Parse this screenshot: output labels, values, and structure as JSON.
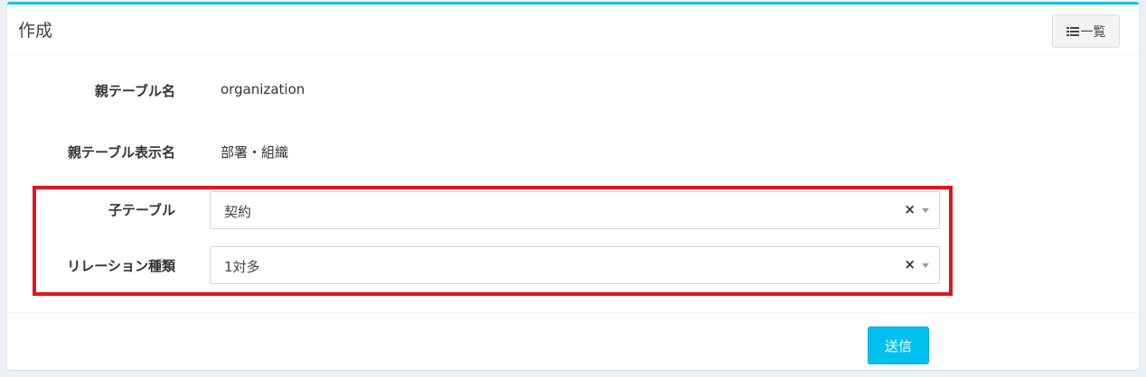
{
  "header": {
    "title": "作成",
    "list_button_label": "一覧",
    "list_button_icon": "list-icon"
  },
  "form": {
    "parent_table_name": {
      "label": "親テーブル名",
      "value": "organization"
    },
    "parent_table_display_name": {
      "label": "親テーブル表示名",
      "value": "部署・組織"
    },
    "child_table": {
      "label": "子テーブル",
      "selected": "契約",
      "clear": "×"
    },
    "relation_type": {
      "label": "リレーション種類",
      "selected": "1対多",
      "clear": "×"
    }
  },
  "footer": {
    "submit_label": "送信"
  },
  "colors": {
    "accent": "#00c0ef",
    "highlight": "#e0161e"
  }
}
